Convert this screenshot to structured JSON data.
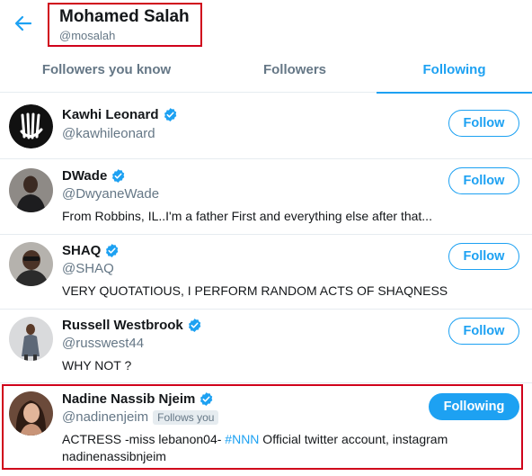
{
  "header": {
    "name": "Mohamed Salah",
    "handle": "@mosalah"
  },
  "tabs": [
    {
      "label": "Followers you know",
      "active": false
    },
    {
      "label": "Followers",
      "active": false
    },
    {
      "label": "Following",
      "active": true
    }
  ],
  "users": [
    {
      "name": "Kawhi Leonard",
      "handle": "@kawhileonard",
      "verified": true,
      "bio": "",
      "button": "Follow"
    },
    {
      "name": "DWade",
      "handle": "@DwyaneWade",
      "verified": true,
      "bio": "From Robbins, IL..I'm a father First and everything else after that...",
      "button": "Follow"
    },
    {
      "name": "SHAQ",
      "handle": "@SHAQ",
      "verified": true,
      "bio": "VERY QUOTATIOUS, I PERFORM RANDOM ACTS OF SHAQNESS",
      "button": "Follow"
    },
    {
      "name": "Russell Westbrook",
      "handle": "@russwest44",
      "verified": true,
      "bio": "WHY NOT ?",
      "button": "Follow"
    },
    {
      "name": "Nadine Nassib Njeim",
      "handle": "@nadinenjeim",
      "verified": true,
      "follows_you": "Follows you",
      "bio_before": "ACTRESS -miss lebanon04- ",
      "bio_hashtag": "#NNN",
      "bio_after": " Official twitter account, instagram nadinenassibnjeim",
      "button": "Following"
    }
  ],
  "colors": {
    "accent": "#1da1f2",
    "highlight": "#d0021b",
    "secondary_text": "#657786"
  },
  "icons": {
    "back": "back-arrow-icon",
    "verified": "verified-badge-icon"
  }
}
